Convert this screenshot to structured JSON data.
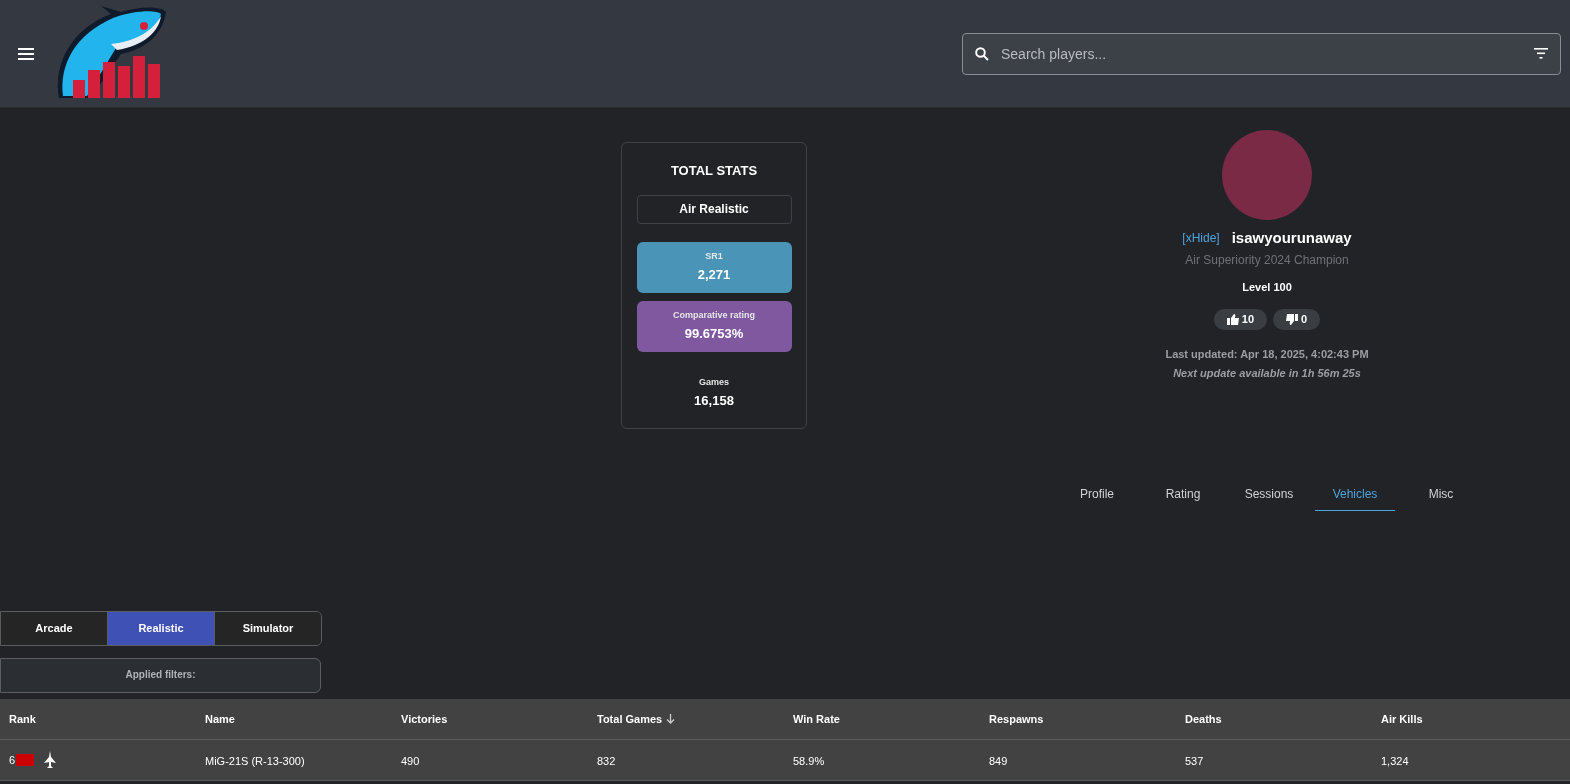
{
  "header": {
    "search": {
      "placeholder": "Search players..."
    }
  },
  "total_stats": {
    "title": "TOTAL STATS",
    "mode": "Air Realistic",
    "cards": [
      {
        "kind": "sr",
        "label": "SR1",
        "value": "2,271"
      },
      {
        "kind": "rating",
        "label": "Comparative rating",
        "value": "99.6753%"
      },
      {
        "kind": "plain",
        "label": "Games",
        "value": "16,158"
      }
    ]
  },
  "profile": {
    "clan": "[xHide]",
    "name": "isawyourunaway",
    "title": "Air Superiority 2024 Champion",
    "level": "Level 100",
    "likes": "10",
    "dislikes": "0",
    "last_updated": "Last updated: Apr 18, 2025, 4:02:43 PM",
    "next_update": "Next update available in 1h 56m 25s"
  },
  "tabs": [
    {
      "label": "Profile",
      "selected": false
    },
    {
      "label": "Rating",
      "selected": false
    },
    {
      "label": "Sessions",
      "selected": false
    },
    {
      "label": "Vehicles",
      "selected": true
    },
    {
      "label": "Misc",
      "selected": false
    }
  ],
  "modes": [
    {
      "label": "Arcade",
      "selected": false
    },
    {
      "label": "Realistic",
      "selected": true
    },
    {
      "label": "Simulator",
      "selected": false
    }
  ],
  "filters": {
    "label": "Applied filters:"
  },
  "table": {
    "columns": [
      {
        "label": "Rank",
        "sorted": false
      },
      {
        "label": "Name",
        "sorted": false
      },
      {
        "label": "Victories",
        "sorted": false
      },
      {
        "label": "Total Games",
        "sorted": true
      },
      {
        "label": "Win Rate",
        "sorted": false
      },
      {
        "label": "Respawns",
        "sorted": false
      },
      {
        "label": "Deaths",
        "sorted": false
      },
      {
        "label": "Air Kills",
        "sorted": false
      }
    ],
    "rows": [
      {
        "cells": [
          "6",
          "MiG-21S (R-13-300)",
          "490",
          "832",
          "58.9%",
          "849",
          "537",
          "1,324"
        ]
      }
    ]
  }
}
